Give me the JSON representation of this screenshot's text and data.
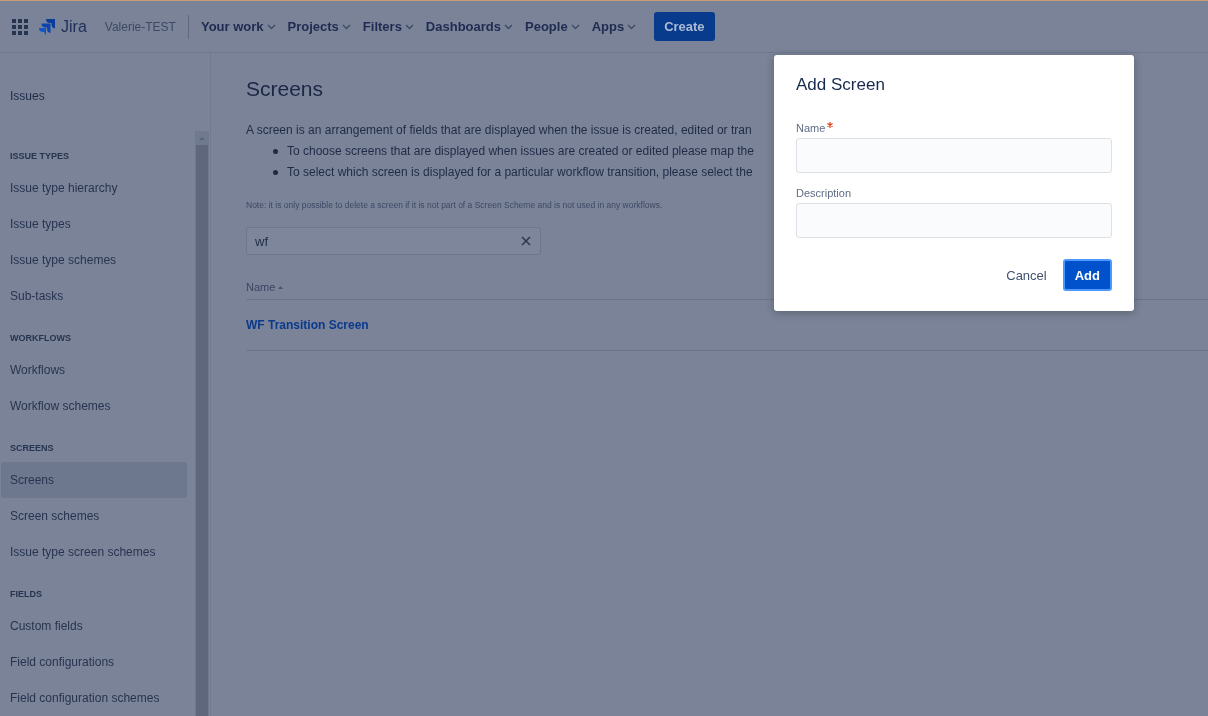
{
  "top_nav": {
    "product": "Jira",
    "site": "Valerie-TEST",
    "menus": [
      "Your work",
      "Projects",
      "Filters",
      "Dashboards",
      "People",
      "Apps"
    ],
    "create_button": "Create"
  },
  "sidebar": {
    "heading": "Issues",
    "sections": [
      {
        "title": "ISSUE TYPES",
        "items": [
          {
            "label": "Issue type hierarchy",
            "selected": false
          },
          {
            "label": "Issue types",
            "selected": false
          },
          {
            "label": "Issue type schemes",
            "selected": false
          },
          {
            "label": "Sub-tasks",
            "selected": false
          }
        ]
      },
      {
        "title": "WORKFLOWS",
        "items": [
          {
            "label": "Workflows",
            "selected": false
          },
          {
            "label": "Workflow schemes",
            "selected": false
          }
        ]
      },
      {
        "title": "SCREENS",
        "items": [
          {
            "label": "Screens",
            "selected": true
          },
          {
            "label": "Screen schemes",
            "selected": false
          },
          {
            "label": "Issue type screen schemes",
            "selected": false
          }
        ]
      },
      {
        "title": "FIELDS",
        "items": [
          {
            "label": "Custom fields",
            "selected": false
          },
          {
            "label": "Field configurations",
            "selected": false
          },
          {
            "label": "Field configuration schemes",
            "selected": false
          }
        ]
      }
    ]
  },
  "page": {
    "title": "Screens",
    "intro": "A screen is an arrangement of fields that are displayed when the issue is created, edited or tran",
    "bullets": [
      "To choose screens that are displayed when issues are created or edited please map the",
      "To select which screen is displayed for a particular workflow transition, please select the"
    ],
    "note": "Note: it is only possible to delete a screen if it is not part of a Screen Scheme and is not used in any workflows.",
    "filter": {
      "value": "wf"
    },
    "table": {
      "columns": [
        "Name"
      ],
      "rows": [
        [
          "WF Transition Screen"
        ]
      ]
    }
  },
  "dialog": {
    "title": "Add Screen",
    "fields": [
      {
        "label": "Name",
        "required": true
      },
      {
        "label": "Description",
        "required": false
      }
    ],
    "buttons": [
      {
        "label": "Cancel",
        "kind": "link"
      },
      {
        "label": "Add",
        "kind": "primary"
      }
    ]
  }
}
